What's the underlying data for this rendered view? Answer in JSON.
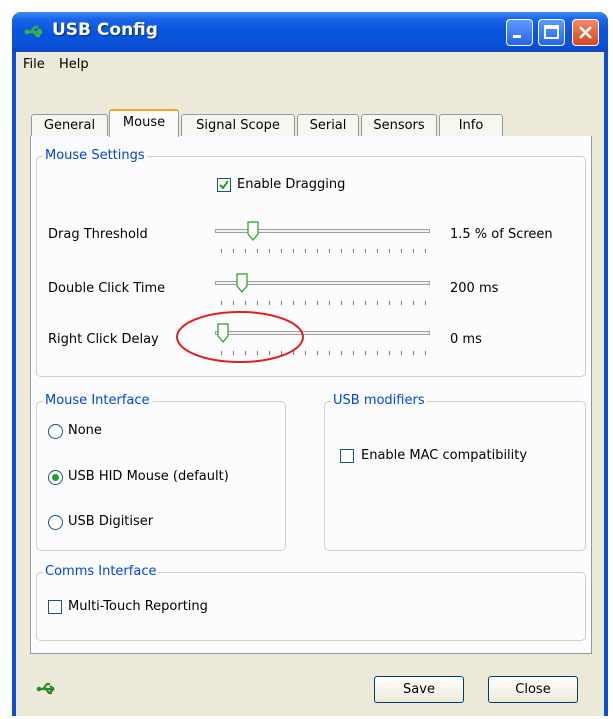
{
  "window": {
    "title": "USB Config"
  },
  "menu": {
    "file": "File",
    "help": "Help"
  },
  "tabs": [
    "General",
    "Mouse",
    "Signal Scope",
    "Serial",
    "Sensors",
    "Info"
  ],
  "active_tab": "Mouse",
  "mouse_settings": {
    "title": "Mouse Settings",
    "enable_dragging": {
      "label": "Enable Dragging",
      "checked": true
    },
    "drag_threshold": {
      "label": "Drag Threshold",
      "value_text": "1.5 % of Screen"
    },
    "double_click_time": {
      "label": "Double Click Time",
      "value_text": "200 ms"
    },
    "right_click_delay": {
      "label": "Right Click Delay",
      "value_text": "0 ms"
    }
  },
  "mouse_interface": {
    "title": "Mouse Interface",
    "options": [
      "None",
      "USB HID Mouse (default)",
      "USB Digitiser"
    ],
    "selected": "USB HID Mouse (default)"
  },
  "usb_modifiers": {
    "title": "USB modifiers",
    "enable_mac": {
      "label": "Enable MAC compatibility",
      "checked": false
    }
  },
  "comms_interface": {
    "title": "Comms Interface",
    "multi_touch": {
      "label": "Multi-Touch Reporting",
      "checked": false
    }
  },
  "buttons": {
    "save": "Save",
    "close": "Close"
  },
  "colors": {
    "accent": "#0a4fd6",
    "group_title": "#0046d5",
    "annotation": "#e02020"
  }
}
